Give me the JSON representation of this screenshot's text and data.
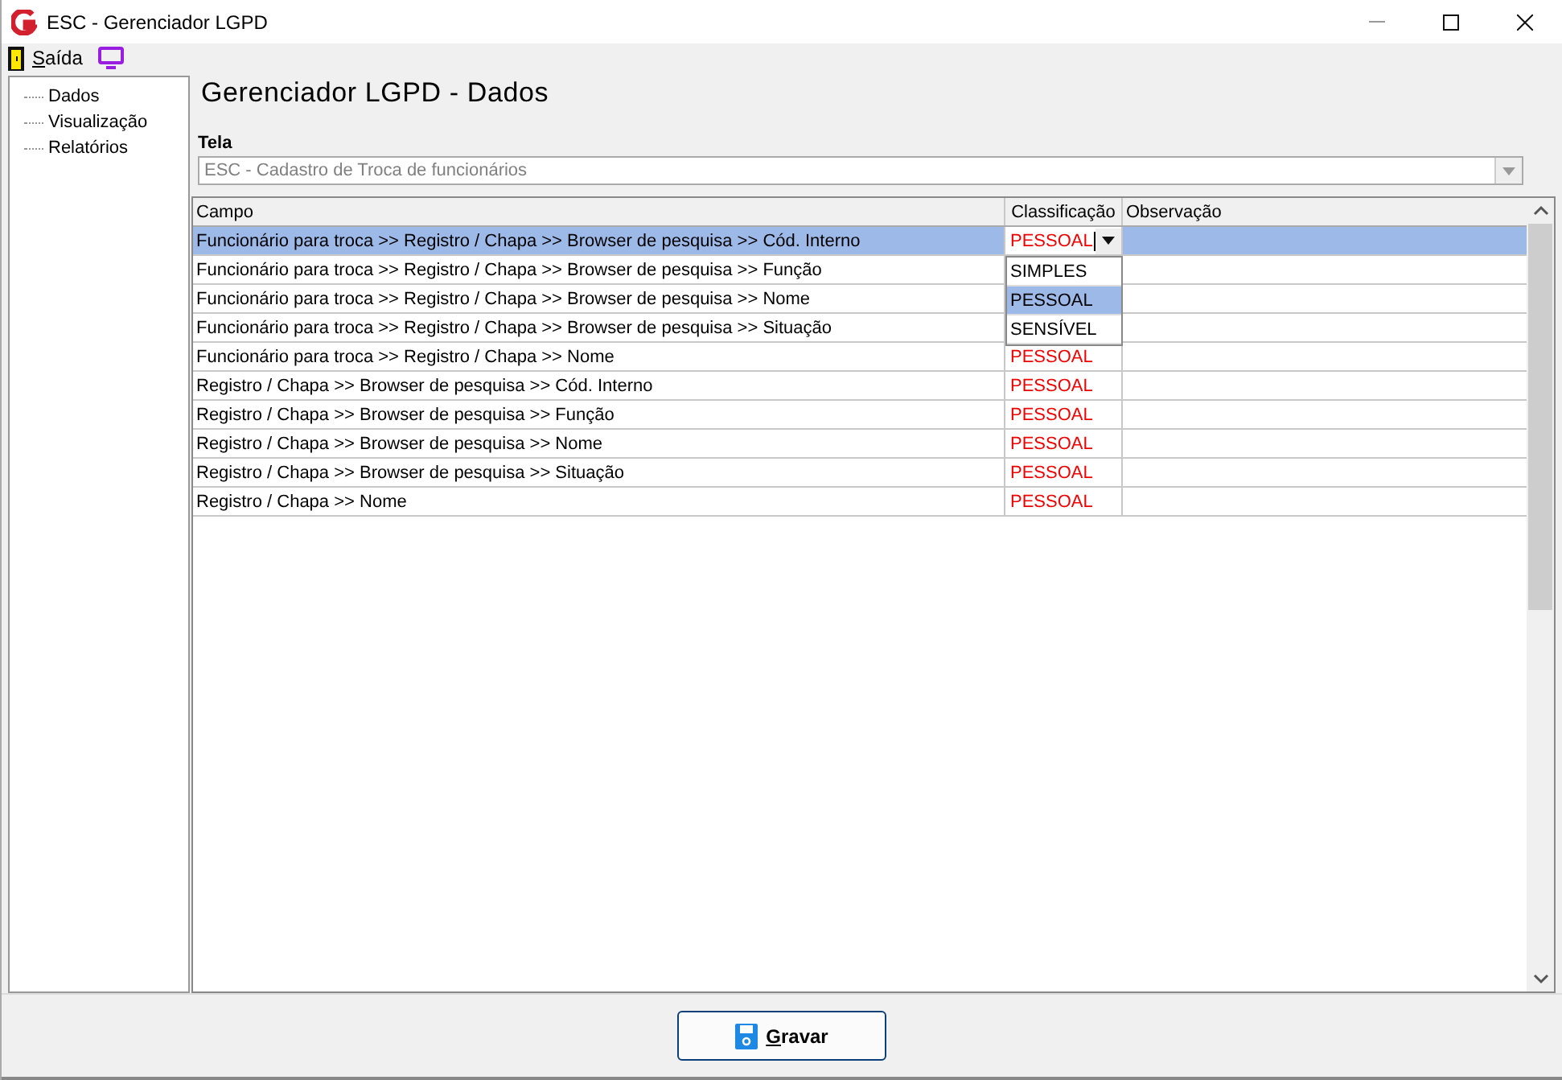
{
  "window": {
    "title": "ESC - Gerenciador LGPD"
  },
  "menu": [
    {
      "label": "Saída",
      "kind": "exit"
    },
    {
      "kind": "screen"
    }
  ],
  "sidebar": {
    "items": [
      {
        "label": "Dados",
        "selected": false
      },
      {
        "label": "Visualização",
        "selected": false
      },
      {
        "label": "Relatórios",
        "selected": false
      }
    ]
  },
  "heading": "Gerenciador LGPD - Dados",
  "tela": {
    "label": "Tela",
    "value": "ESC - Cadastro de Troca de funcionários",
    "disabled": true
  },
  "table": {
    "columns": [
      "Campo",
      "Classificação",
      "Observação"
    ],
    "rows": [
      {
        "campo": "Funcionário para troca >> Registro / Chapa  >> Browser de pesquisa >> Cód. Interno",
        "classificacao": "PESSOAL",
        "selected": true,
        "editing": true
      },
      {
        "campo": "Funcionário para troca >> Registro / Chapa  >> Browser de pesquisa >> Função",
        "selected": false,
        "editing": false
      },
      {
        "campo": "Funcionário para troca >> Registro / Chapa  >> Browser de pesquisa >> Nome",
        "selected": false,
        "editing": false
      },
      {
        "campo": "Funcionário para troca >> Registro / Chapa  >> Browser de pesquisa >> Situação",
        "selected": false,
        "editing": false
      },
      {
        "campo": "Funcionário para troca >> Registro / Chapa >> Nome",
        "classificacao": "PESSOAL",
        "selected": false,
        "editing": false
      },
      {
        "campo": "Registro / Chapa >> Browser de pesquisa >> Cód. Interno",
        "classificacao": "PESSOAL",
        "selected": false,
        "editing": false
      },
      {
        "campo": "Registro / Chapa >> Browser de pesquisa >> Função",
        "classificacao": "PESSOAL",
        "selected": false,
        "editing": false
      },
      {
        "campo": "Registro / Chapa >> Browser de pesquisa >> Nome",
        "classificacao": "PESSOAL",
        "selected": false,
        "editing": false
      },
      {
        "campo": "Registro / Chapa >> Browser de pesquisa >> Situação",
        "classificacao": "PESSOAL",
        "selected": false,
        "editing": false
      },
      {
        "campo": "Registro / Chapa >> Nome",
        "classificacao": "PESSOAL",
        "selected": false,
        "editing": false
      }
    ],
    "dropdown": {
      "options": [
        {
          "label": "SIMPLES",
          "selected": false
        },
        {
          "label": "PESSOAL",
          "selected": true
        },
        {
          "label": "SENSÍVEL",
          "selected": false
        }
      ]
    }
  },
  "buttons": [
    {
      "label": "Gravar"
    }
  ]
}
